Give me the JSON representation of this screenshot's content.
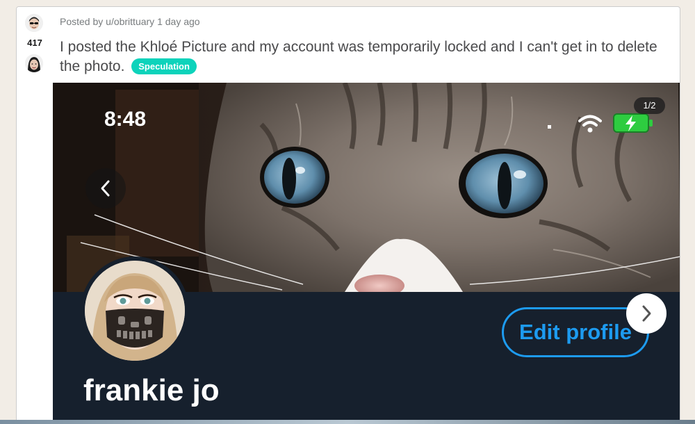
{
  "post": {
    "meta": "Posted by u/obrittuary 1 day ago",
    "score": "417",
    "title": "I posted the Khloé Picture and my account was temporarily locked and I can't get in to delete the photo.",
    "flair": "Speculation",
    "flair_color": "#0dd3bb"
  },
  "gallery": {
    "counter": "1/2",
    "prev_icon": "chevron-left-icon",
    "next_icon": "chevron-right-icon"
  },
  "screenshot": {
    "status_time": "8:48",
    "edit_profile_label": "Edit profile",
    "display_name": "frankie jo",
    "accent": "#1d9bf0"
  },
  "icons": {
    "upvote": "upvote-avatar-icon",
    "downvote": "downvote-avatar-icon",
    "wifi": "wifi-icon",
    "battery": "battery-charging-icon"
  }
}
